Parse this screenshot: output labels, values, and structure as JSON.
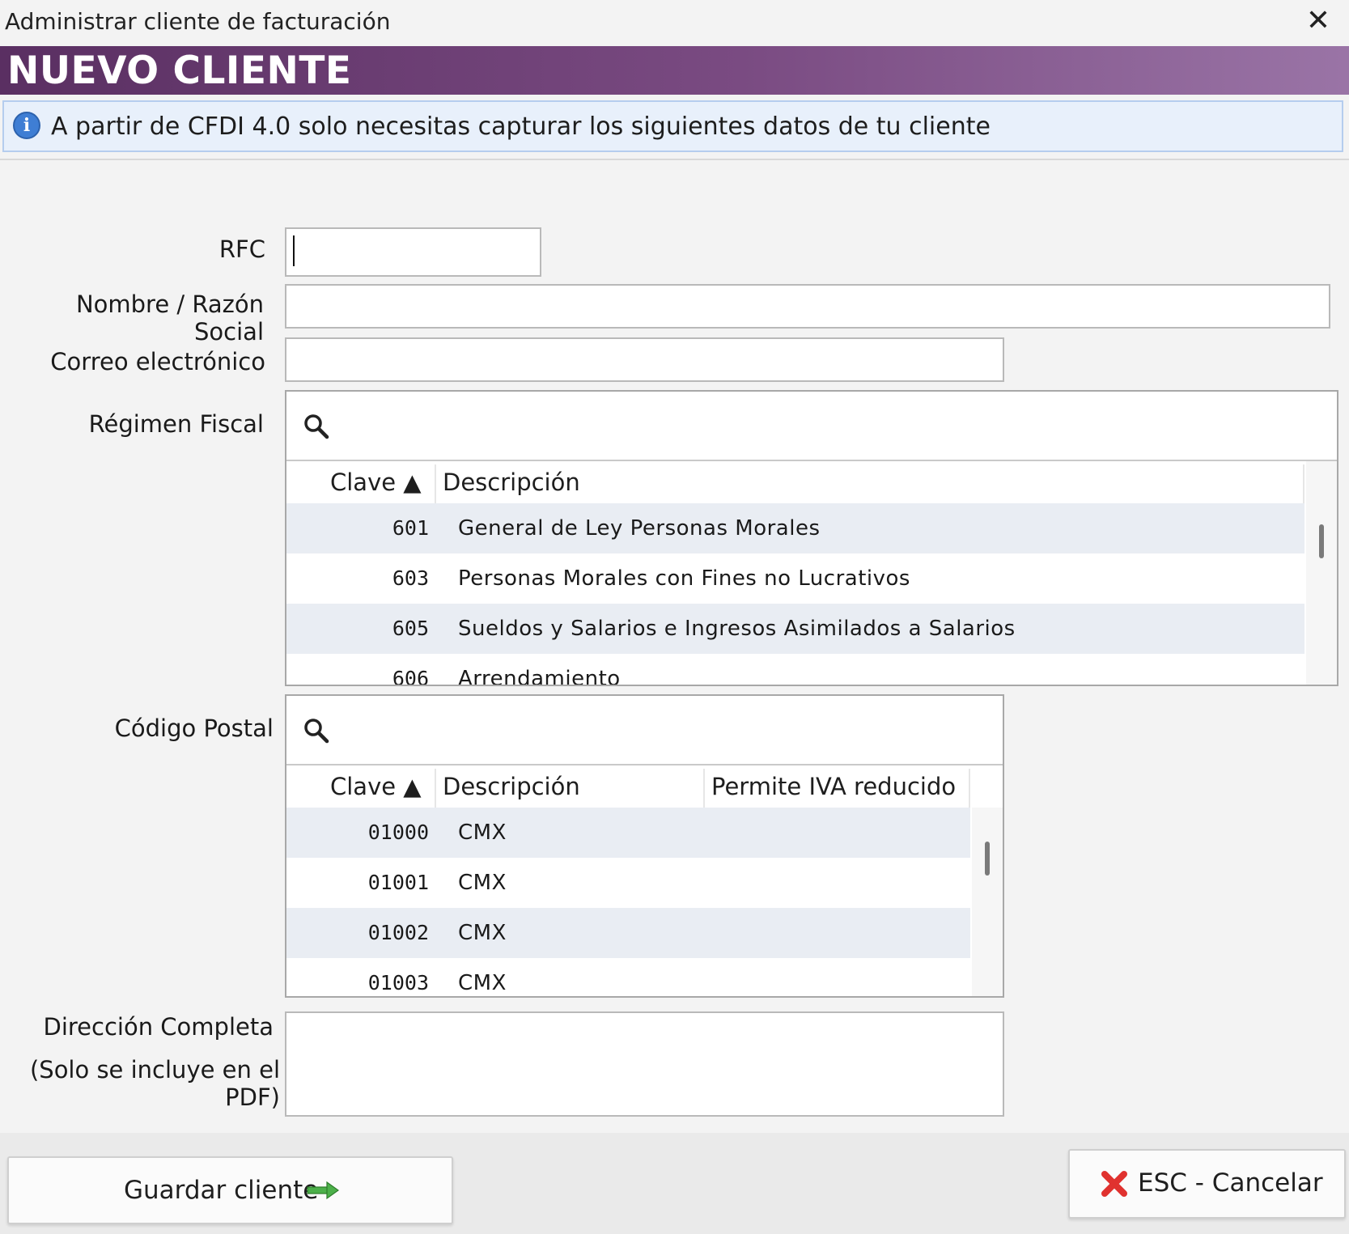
{
  "window": {
    "title": "Administrar cliente de facturación",
    "close_glyph": "✕"
  },
  "header": {
    "heading": "NUEVO CLIENTE"
  },
  "info": {
    "icon": "info-icon",
    "icon_glyph": "i",
    "text": "A partir de CFDI 4.0 solo necesitas capturar los siguientes datos de tu cliente"
  },
  "form": {
    "rfc": {
      "label": "RFC",
      "value": ""
    },
    "nombre": {
      "label": "Nombre / Razón Social",
      "value": ""
    },
    "correo": {
      "label": "Correo electrónico",
      "value": ""
    },
    "regimen": {
      "label": "Régimen Fiscal",
      "search_value": "",
      "columns": {
        "clave": "Clave ▲",
        "descripcion": "Descripción"
      },
      "rows": [
        {
          "clave": "601",
          "descripcion": "General de Ley Personas Morales"
        },
        {
          "clave": "603",
          "descripcion": "Personas Morales con Fines no Lucrativos"
        },
        {
          "clave": "605",
          "descripcion": "Sueldos y Salarios e Ingresos Asimilados a Salarios"
        },
        {
          "clave": "606",
          "descripcion": "Arrendamiento"
        }
      ]
    },
    "codigo_postal": {
      "label": "Código Postal",
      "search_value": "",
      "columns": {
        "clave": "Clave ▲",
        "descripcion": "Descripción",
        "iva": "Permite IVA reducido"
      },
      "rows": [
        {
          "clave": "01000",
          "descripcion": "CMX",
          "iva": ""
        },
        {
          "clave": "01001",
          "descripcion": "CMX",
          "iva": ""
        },
        {
          "clave": "01002",
          "descripcion": "CMX",
          "iva": ""
        },
        {
          "clave": "01003",
          "descripcion": "CMX",
          "iva": ""
        }
      ]
    },
    "direccion": {
      "label": "Dirección Completa",
      "sublabel": "(Solo se incluye en el PDF)",
      "value": ""
    }
  },
  "footer": {
    "save_label": "Guardar cliente",
    "save_icon": "arrow-right-icon",
    "cancel_label": "ESC - Cancelar",
    "cancel_icon": "red-x-icon"
  },
  "colors": {
    "banner": "#6b3f73",
    "info_bg": "#e8f0fb",
    "row_alt": "#e9edf3",
    "cancel_red": "#e0322f",
    "arrow_green": "#4cb04a"
  }
}
